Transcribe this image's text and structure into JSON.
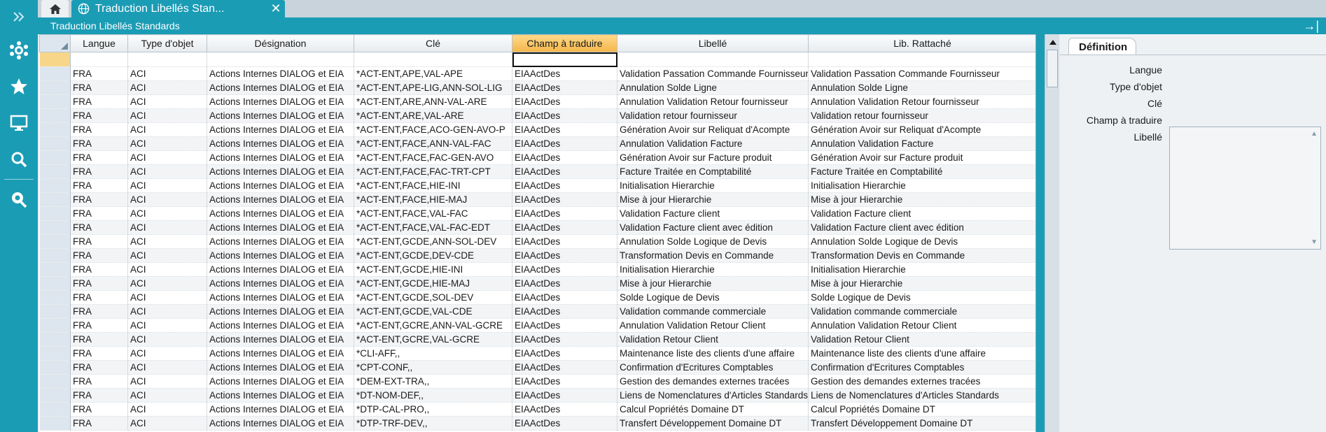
{
  "sidebar": {
    "items": [
      {
        "name": "expand-icon"
      },
      {
        "name": "network-icon"
      },
      {
        "name": "star-icon"
      },
      {
        "name": "monitor-icon"
      },
      {
        "name": "search-icon"
      },
      {
        "name": "location-search-icon"
      }
    ],
    "color": "#1b9cb5"
  },
  "tabs": {
    "home_icon": "home-icon",
    "doc_tab_title": "Traduction Libellés Stan...",
    "close_glyph": "✕"
  },
  "window": {
    "title": "Traduction Libellés Standards",
    "pin_glyph": "→|"
  },
  "grid": {
    "columns": [
      "Langue",
      "Type d'objet",
      "Désignation",
      "Clé",
      "Champ à traduire",
      "Libellé",
      "Lib. Rattaché"
    ],
    "selected_column": "Champ à traduire",
    "rows": [
      [
        "FRA",
        "ACI",
        "Actions Internes DIALOG et EIA",
        "*ACT-ENT,APE,VAL-APE",
        "EIAActDes",
        "Validation Passation Commande Fournisseur",
        "Validation Passation Commande Fournisseur"
      ],
      [
        "FRA",
        "ACI",
        "Actions Internes DIALOG et EIA",
        "*ACT-ENT,APE-LIG,ANN-SOL-LIG",
        "EIAActDes",
        "Annulation Solde Ligne",
        "Annulation Solde Ligne"
      ],
      [
        "FRA",
        "ACI",
        "Actions Internes DIALOG et EIA",
        "*ACT-ENT,ARE,ANN-VAL-ARE",
        "EIAActDes",
        "Annulation Validation Retour fournisseur",
        "Annulation Validation Retour fournisseur"
      ],
      [
        "FRA",
        "ACI",
        "Actions Internes DIALOG et EIA",
        "*ACT-ENT,ARE,VAL-ARE",
        "EIAActDes",
        "Validation retour fournisseur",
        "Validation retour fournisseur"
      ],
      [
        "FRA",
        "ACI",
        "Actions Internes DIALOG et EIA",
        "*ACT-ENT,FACE,ACO-GEN-AVO-P",
        "EIAActDes",
        "Génération Avoir sur Reliquat d'Acompte",
        "Génération Avoir sur Reliquat d'Acompte"
      ],
      [
        "FRA",
        "ACI",
        "Actions Internes DIALOG et EIA",
        "*ACT-ENT,FACE,ANN-VAL-FAC",
        "EIAActDes",
        "Annulation Validation Facture",
        "Annulation Validation Facture"
      ],
      [
        "FRA",
        "ACI",
        "Actions Internes DIALOG et EIA",
        "*ACT-ENT,FACE,FAC-GEN-AVO",
        "EIAActDes",
        "Génération Avoir sur Facture produit",
        "Génération Avoir sur Facture produit"
      ],
      [
        "FRA",
        "ACI",
        "Actions Internes DIALOG et EIA",
        "*ACT-ENT,FACE,FAC-TRT-CPT",
        "EIAActDes",
        "Facture Traitée en Comptabilité",
        "Facture Traitée en Comptabilité"
      ],
      [
        "FRA",
        "ACI",
        "Actions Internes DIALOG et EIA",
        "*ACT-ENT,FACE,HIE-INI",
        "EIAActDes",
        "Initialisation Hierarchie",
        "Initialisation Hierarchie"
      ],
      [
        "FRA",
        "ACI",
        "Actions Internes DIALOG et EIA",
        "*ACT-ENT,FACE,HIE-MAJ",
        "EIAActDes",
        "Mise à jour Hierarchie",
        "Mise à jour Hierarchie"
      ],
      [
        "FRA",
        "ACI",
        "Actions Internes DIALOG et EIA",
        "*ACT-ENT,FACE,VAL-FAC",
        "EIAActDes",
        "Validation Facture client",
        "Validation Facture client"
      ],
      [
        "FRA",
        "ACI",
        "Actions Internes DIALOG et EIA",
        "*ACT-ENT,FACE,VAL-FAC-EDT",
        "EIAActDes",
        "Validation Facture client avec édition",
        "Validation Facture client avec édition"
      ],
      [
        "FRA",
        "ACI",
        "Actions Internes DIALOG et EIA",
        "*ACT-ENT,GCDE,ANN-SOL-DEV",
        "EIAActDes",
        "Annulation Solde Logique de Devis",
        "Annulation Solde Logique de Devis"
      ],
      [
        "FRA",
        "ACI",
        "Actions Internes DIALOG et EIA",
        "*ACT-ENT,GCDE,DEV-CDE",
        "EIAActDes",
        "Transformation Devis en Commande",
        "Transformation Devis en Commande"
      ],
      [
        "FRA",
        "ACI",
        "Actions Internes DIALOG et EIA",
        "*ACT-ENT,GCDE,HIE-INI",
        "EIAActDes",
        "Initialisation Hierarchie",
        "Initialisation Hierarchie"
      ],
      [
        "FRA",
        "ACI",
        "Actions Internes DIALOG et EIA",
        "*ACT-ENT,GCDE,HIE-MAJ",
        "EIAActDes",
        "Mise à jour Hierarchie",
        "Mise à jour Hierarchie"
      ],
      [
        "FRA",
        "ACI",
        "Actions Internes DIALOG et EIA",
        "*ACT-ENT,GCDE,SOL-DEV",
        "EIAActDes",
        "Solde Logique de Devis",
        "Solde Logique de Devis"
      ],
      [
        "FRA",
        "ACI",
        "Actions Internes DIALOG et EIA",
        "*ACT-ENT,GCDE,VAL-CDE",
        "EIAActDes",
        "Validation commande commerciale",
        "Validation commande commerciale"
      ],
      [
        "FRA",
        "ACI",
        "Actions Internes DIALOG et EIA",
        "*ACT-ENT,GCRE,ANN-VAL-GCRE",
        "EIAActDes",
        "Annulation Validation Retour Client",
        "Annulation Validation Retour Client"
      ],
      [
        "FRA",
        "ACI",
        "Actions Internes DIALOG et EIA",
        "*ACT-ENT,GCRE,VAL-GCRE",
        "EIAActDes",
        "Validation Retour Client",
        "Validation Retour Client"
      ],
      [
        "FRA",
        "ACI",
        "Actions Internes DIALOG et EIA",
        "*CLI-AFF,,",
        "EIAActDes",
        "Maintenance liste des clients d'une affaire",
        "Maintenance liste des clients d'une affaire"
      ],
      [
        "FRA",
        "ACI",
        "Actions Internes DIALOG et EIA",
        "*CPT-CONF,,",
        "EIAActDes",
        "Confirmation d'Ecritures Comptables",
        "Confirmation d'Ecritures Comptables"
      ],
      [
        "FRA",
        "ACI",
        "Actions Internes DIALOG et EIA",
        "*DEM-EXT-TRA,,",
        "EIAActDes",
        "Gestion des demandes externes tracées",
        "Gestion des demandes externes tracées"
      ],
      [
        "FRA",
        "ACI",
        "Actions Internes DIALOG et EIA",
        "*DT-NOM-DEF,,",
        "EIAActDes",
        "Liens de Nomenclatures d'Articles Standards",
        "Liens de Nomenclatures d'Articles Standards"
      ],
      [
        "FRA",
        "ACI",
        "Actions Internes DIALOG et EIA",
        "*DTP-CAL-PRO,,",
        "EIAActDes",
        "Calcul Popriétés Domaine DT",
        "Calcul Popriétés Domaine DT"
      ],
      [
        "FRA",
        "ACI",
        "Actions Internes DIALOG et EIA",
        "*DTP-TRF-DEV,,",
        "EIAActDes",
        "Transfert Développement Domaine DT",
        "Transfert Développement Domaine DT"
      ]
    ]
  },
  "panel": {
    "tab_label": "Définition",
    "labels": [
      "Langue",
      "Type d'objet",
      "Clé",
      "Champ à traduire",
      "Libellé"
    ]
  }
}
